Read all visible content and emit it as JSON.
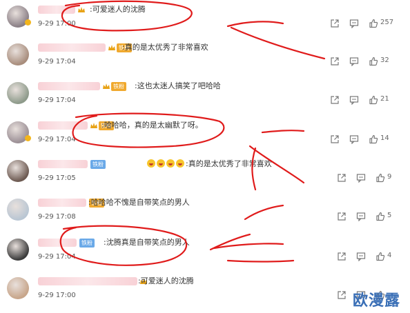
{
  "comments": [
    {
      "text": "可爱迷人的沈腾",
      "time": "9-29 17:00",
      "likes": "257",
      "badge": "",
      "badge_color": "gold",
      "has_crown": true,
      "avatar_color": "#8a7f86",
      "emojis": 0
    },
    {
      "text": "真的是太优秀了非常喜欢",
      "time": "9-29 17:04",
      "likes": "32",
      "badge": "铁粉",
      "badge_color": "gold",
      "has_crown": true,
      "avatar_color": "#a88d7c",
      "emojis": 0
    },
    {
      "text": "这也太迷人搞笑了吧哈哈",
      "time": "9-29 17:04",
      "likes": "21",
      "badge": "铁粉",
      "badge_color": "gold",
      "has_crown": true,
      "avatar_color": "#8d9a8a",
      "emojis": 0
    },
    {
      "text": "哈哈哈，真的是太幽默了呀。",
      "time": "9-29 17:04",
      "likes": "14",
      "badge": "铁粉",
      "badge_color": "gold",
      "has_crown": true,
      "avatar_color": "#9b8f95",
      "emojis": 0
    },
    {
      "text": "真的是太优秀了非常喜欢",
      "time": "9-29 17:05",
      "likes": "9",
      "badge": "铁粉",
      "badge_color": "blue",
      "has_crown": false,
      "avatar_color": "#6d5a52",
      "emojis": 4
    },
    {
      "text": "哈哈哈不愧是自带笑点的男人",
      "time": "9-29 17:08",
      "likes": "5",
      "badge": "铁粉",
      "badge_color": "gold",
      "has_crown": false,
      "avatar_color": "#b9c6d3",
      "emojis": 0
    },
    {
      "text": "沈腾真是自带笑点的男人",
      "time": "9-29 17:04",
      "likes": "4",
      "badge": "铁粉",
      "badge_color": "blue",
      "has_crown": false,
      "avatar_color": "#3b3b3b",
      "emojis": 0
    },
    {
      "text": "可爱迷人的沈腾",
      "time": "9-29 17:00",
      "likes": "",
      "badge": "",
      "badge_color": "gold",
      "has_crown": true,
      "avatar_color": "#c7a58a",
      "emojis": 0
    }
  ],
  "watermark": "欧漫露",
  "icons": {
    "share": "share-icon",
    "comment": "comment-icon",
    "like": "thumbs-up-icon"
  }
}
